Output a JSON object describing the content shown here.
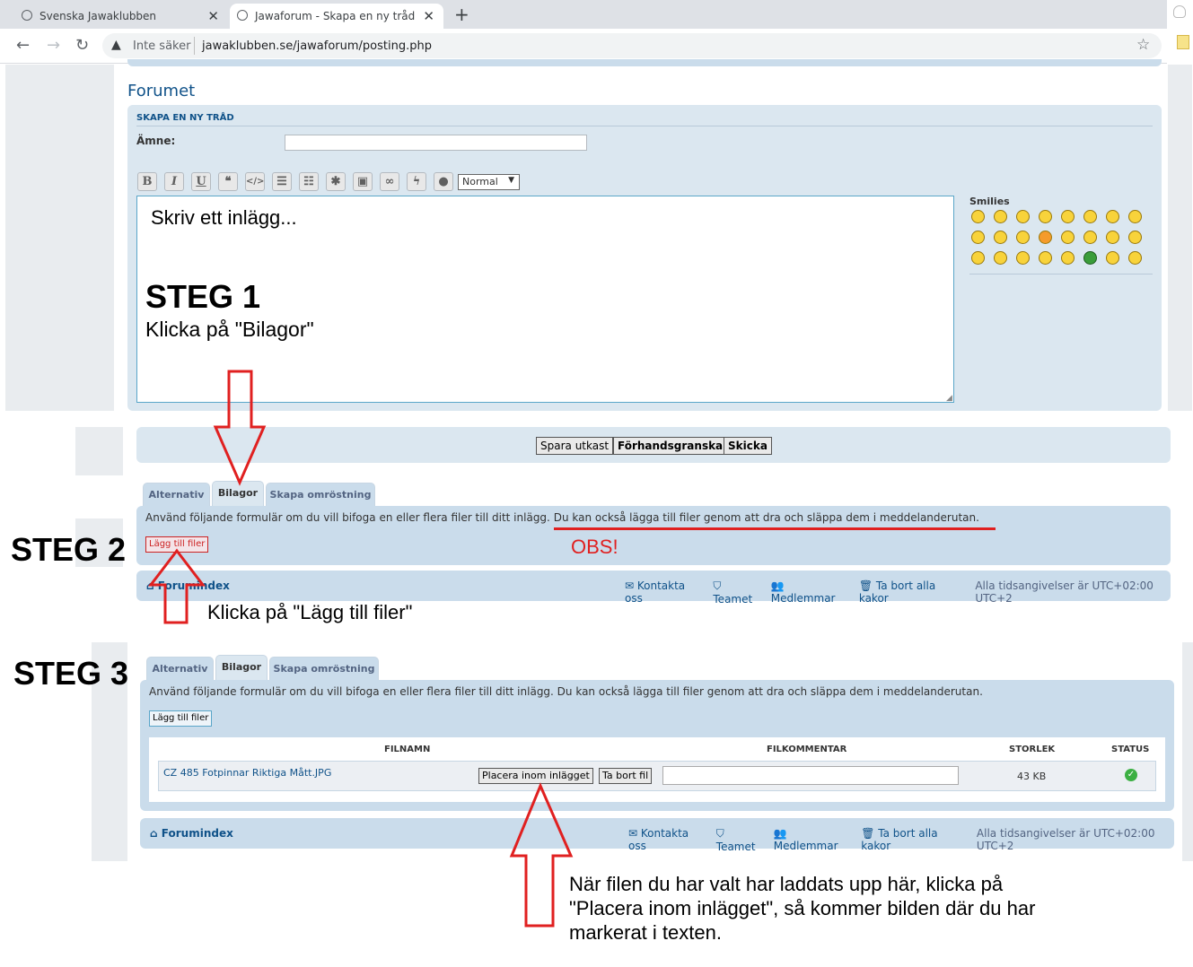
{
  "browser": {
    "tab1_title": "Svenska Jawaklubben",
    "tab2_title": "Jawaforum - Skapa en ny tråd",
    "security": "Inte säker",
    "url": "jawaklubben.se/jawaforum/posting.php"
  },
  "forum": {
    "heading": "Forumet",
    "section": "SKAPA EN NY TRÅD",
    "subject_label": "Ämne:",
    "font_size_select": "Normal",
    "editor_placeholder": "Skriv ett inlägg...",
    "smilies_label": "Smilies",
    "buttons": {
      "save": "Spara utkast",
      "preview": "Förhandsgranska",
      "submit": "Skicka"
    },
    "tabs": {
      "options": "Alternativ",
      "attachments": "Bilagor",
      "poll": "Skapa omröstning"
    },
    "attach_info_1": "Använd följande formulär om du vill bifoga en eller flera filer till ditt inlägg.",
    "attach_info_2": "Du kan också lägga till filer genom att dra och släppa dem i meddelanderutan.",
    "attach_info_full": "Använd följande formulär om du vill bifoga en eller flera filer till ditt inlägg. Du kan också lägga till filer genom att dra och släppa dem i meddelanderutan.",
    "add_files": "Lägg till filer",
    "table": {
      "col_filename": "FILNAMN",
      "col_comment": "FILKOMMENTAR",
      "col_size": "STORLEK",
      "col_status": "STATUS",
      "file_name": "CZ 485 Fotpinnar Riktiga Mått.JPG",
      "place_inline": "Placera inom inlägget",
      "delete_file": "Ta bort fil",
      "file_size": "43 KB"
    },
    "footer": {
      "forumindex": "Forumindex",
      "contact": "Kontakta oss",
      "team": "Teamet",
      "members": "Medlemmar",
      "cookies": "Ta bort alla kakor",
      "timezone": "Alla tidsangivelser är UTC+02:00 UTC+2"
    }
  },
  "annotations": {
    "step1_title": "STEG 1",
    "step1_text": "Klicka på \"Bilagor\"",
    "step2_title": "STEG 2",
    "obs": "OBS!",
    "step2_text": "Klicka på \"Lägg till filer\"",
    "step3_title": "STEG 3",
    "step3_line1": "När filen du har valt har laddats upp här, klicka på",
    "step3_line2": "\"Placera inom inlägget\", så kommer bilden där du har",
    "step3_line3": "markerat i texten."
  },
  "colors": {
    "accent_blue": "#105289",
    "panel": "#cadceb",
    "annotation_red": "#e02020"
  }
}
